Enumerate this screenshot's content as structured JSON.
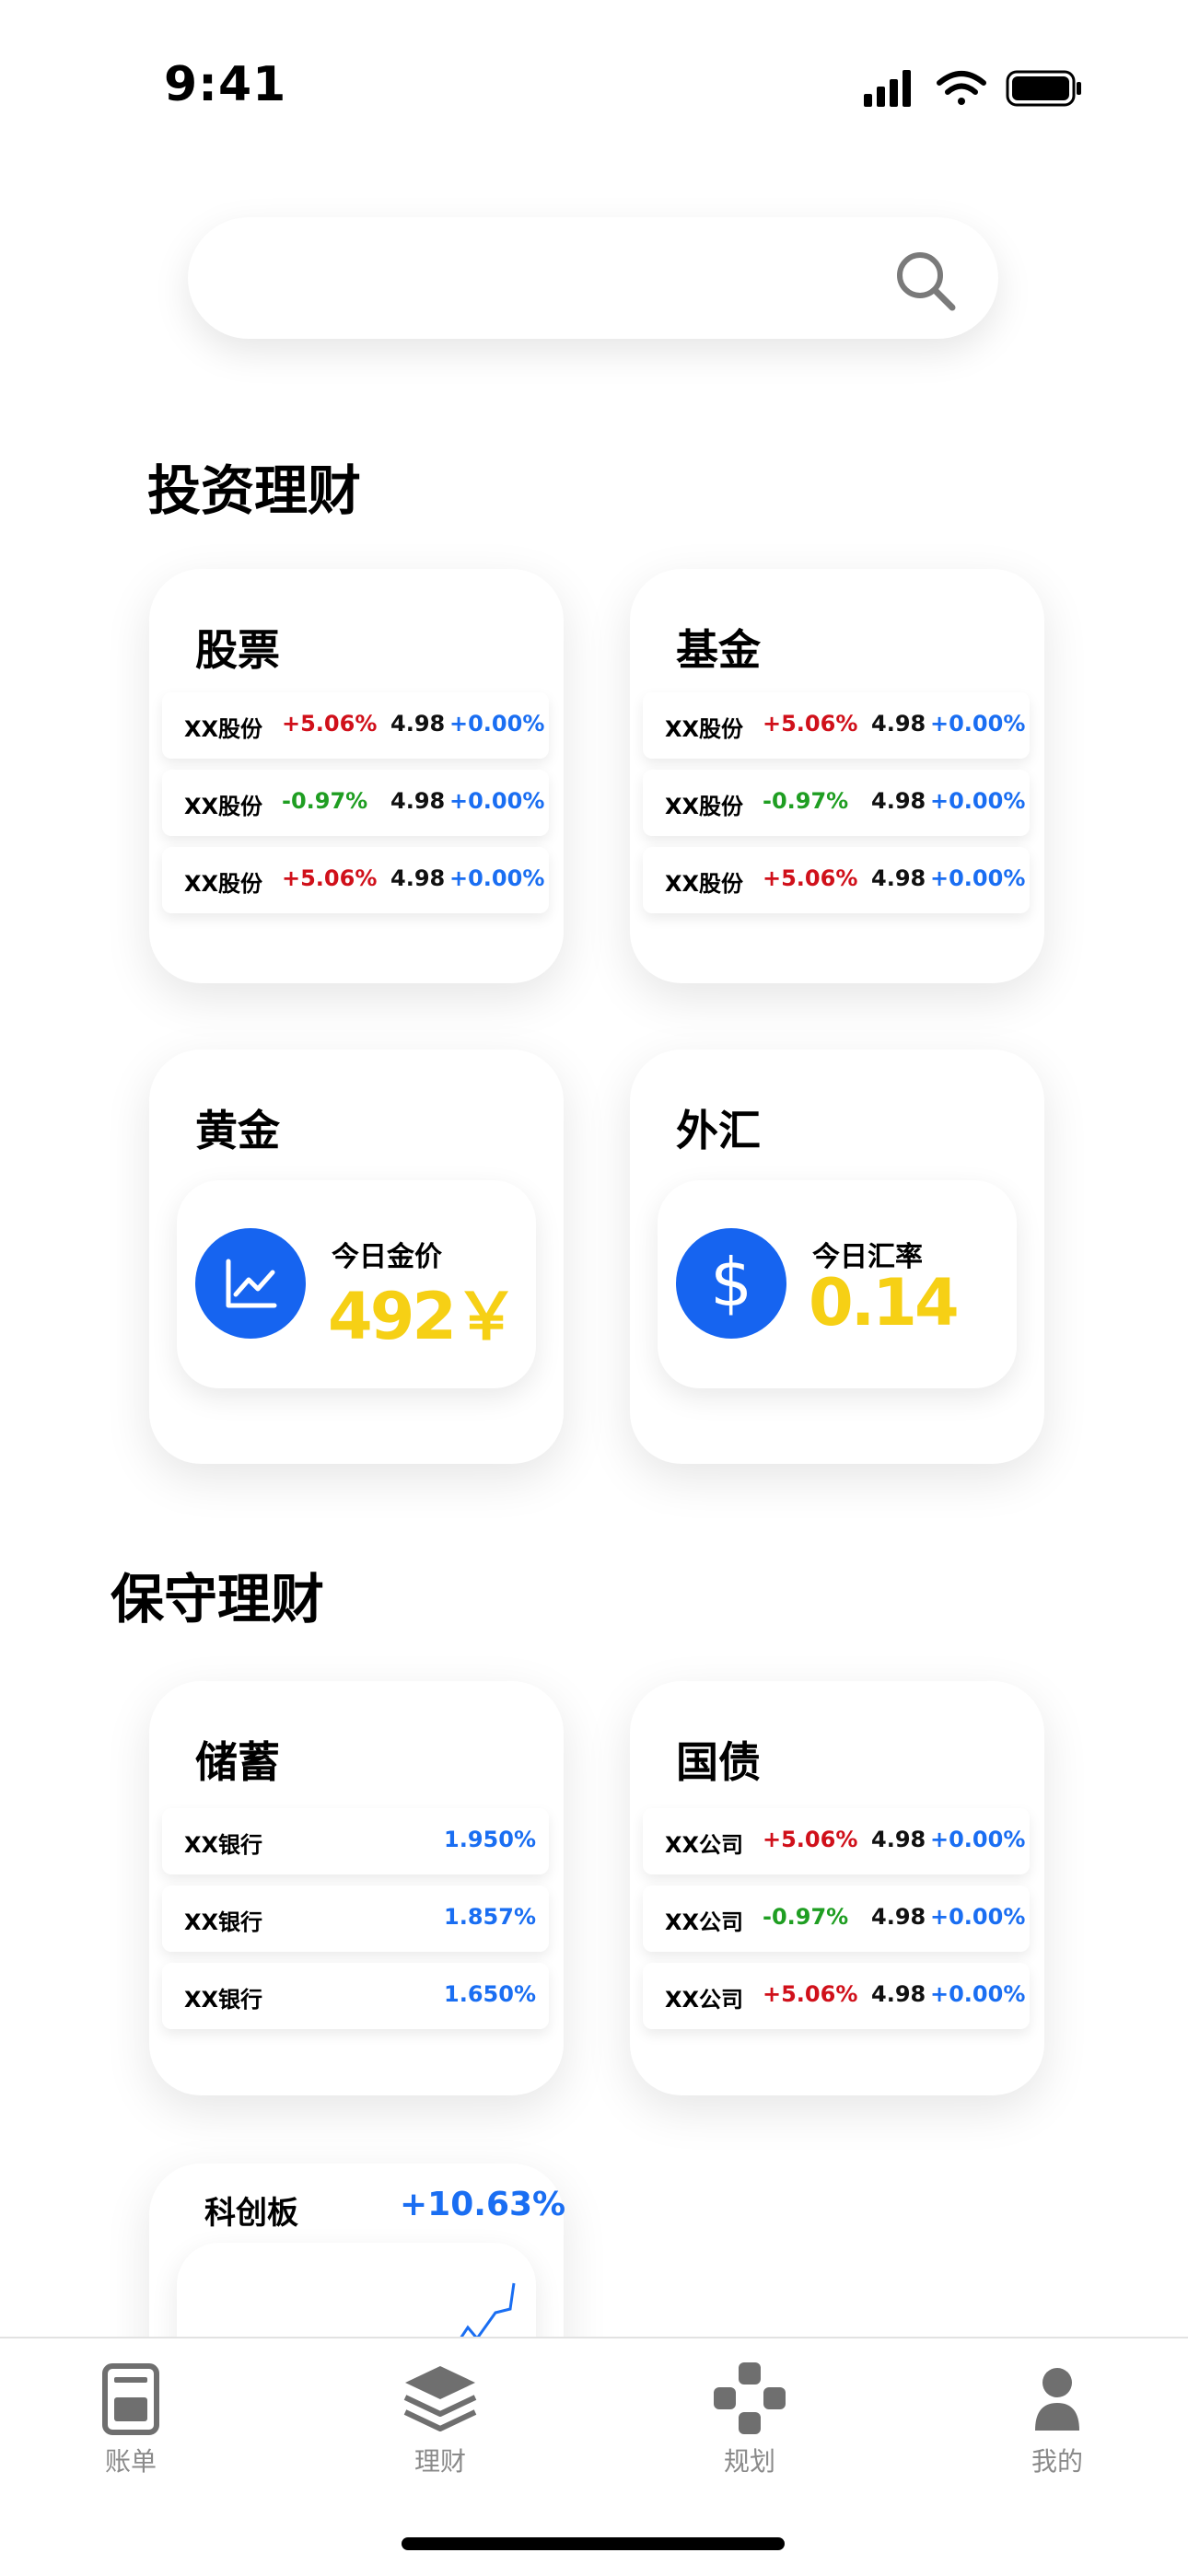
{
  "status": {
    "time": "9:41"
  },
  "search": {
    "placeholder": ""
  },
  "sections": {
    "investment": "投资理财",
    "conservative": "保守理财"
  },
  "stocks": {
    "title": "股票",
    "rows": [
      {
        "name": "XX股份",
        "change": "+5.06%",
        "price": "4.98",
        "pct": "+0.00%"
      },
      {
        "name": "XX股份",
        "change": "-0.97%",
        "price": "4.98",
        "pct": "+0.00%"
      },
      {
        "name": "XX股份",
        "change": "+5.06%",
        "price": "4.98",
        "pct": "+0.00%"
      }
    ]
  },
  "funds": {
    "title": "基金",
    "rows": [
      {
        "name": "XX股份",
        "change": "+5.06%",
        "price": "4.98",
        "pct": "+0.00%"
      },
      {
        "name": "XX股份",
        "change": "-0.97%",
        "price": "4.98",
        "pct": "+0.00%"
      },
      {
        "name": "XX股份",
        "change": "+5.06%",
        "price": "4.98",
        "pct": "+0.00%"
      }
    ]
  },
  "gold": {
    "title": "黄金",
    "label": "今日金价",
    "value": "492￥"
  },
  "forex": {
    "title": "外汇",
    "label": "今日汇率",
    "value": "0.14"
  },
  "savings": {
    "title": "储蓄",
    "rows": [
      {
        "name": "XX银行",
        "rate": "1.950%"
      },
      {
        "name": "XX银行",
        "rate": "1.857%"
      },
      {
        "name": "XX银行",
        "rate": "1.650%"
      }
    ]
  },
  "bonds": {
    "title": "国债",
    "rows": [
      {
        "name": "XX公司",
        "change": "+5.06%",
        "price": "4.98",
        "pct": "+0.00%"
      },
      {
        "name": "XX公司",
        "change": "-0.97%",
        "price": "4.98",
        "pct": "+0.00%"
      },
      {
        "name": "XX公司",
        "change": "+5.06%",
        "price": "4.98",
        "pct": "+0.00%"
      }
    ]
  },
  "star_market": {
    "title": "科创板",
    "change": "+10.63%"
  },
  "tabs": [
    {
      "label": "账单",
      "icon": "bill-icon"
    },
    {
      "label": "理财",
      "icon": "layers-icon"
    },
    {
      "label": "规划",
      "icon": "gamepad-icon"
    },
    {
      "label": "我的",
      "icon": "user-icon"
    }
  ],
  "colors": {
    "accent": "#1664f0",
    "up": "#d0101a",
    "down": "#1f9e22",
    "highlight": "#f6d015"
  }
}
